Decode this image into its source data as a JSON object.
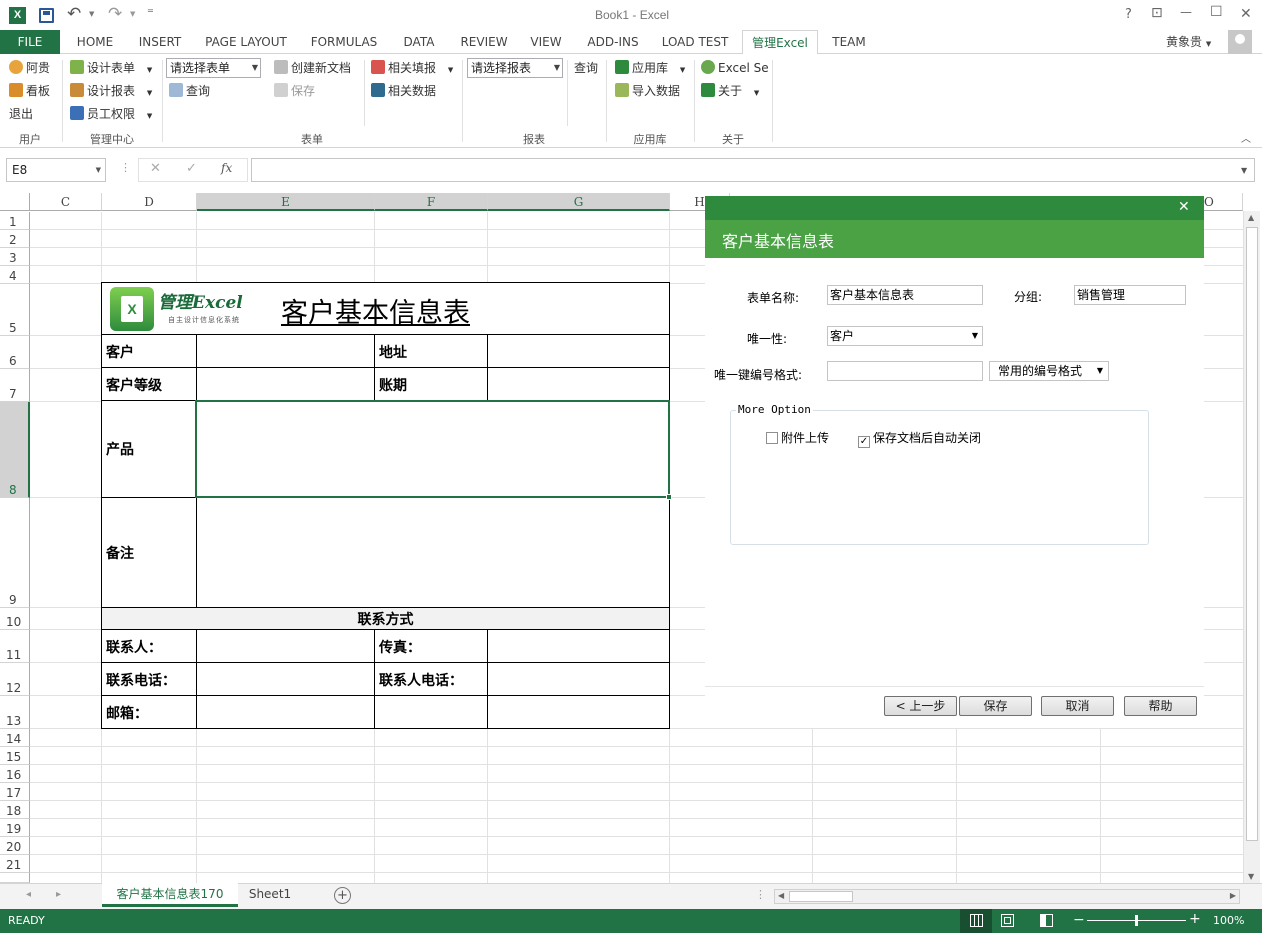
{
  "window": {
    "title": "Book1 - Excel",
    "help": "?",
    "ribbon_opts": "⊡",
    "minimize": "—",
    "maximize": "☐",
    "close": "✕"
  },
  "quick_access": {
    "undo": "↶",
    "redo": "↷",
    "customize": "⁼"
  },
  "tabs": [
    "FILE",
    "HOME",
    "INSERT",
    "PAGE LAYOUT",
    "FORMULAS",
    "DATA",
    "REVIEW",
    "VIEW",
    "ADD-INS",
    "LOAD TEST",
    "管理Excel",
    "TEAM"
  ],
  "user": {
    "name": "黄象贵"
  },
  "ribbon": {
    "user_group": {
      "label": "用户",
      "items": [
        "阿贵",
        "看板",
        "退出"
      ]
    },
    "mgmt_group": {
      "label": "管理中心",
      "items": [
        "设计表单",
        "设计报表",
        "员工权限"
      ]
    },
    "form_group": {
      "label": "表单",
      "combo": "请选择表单",
      "items": [
        "查询",
        "创建新文档",
        "保存",
        "相关填报",
        "相关数据"
      ]
    },
    "report_group": {
      "label": "报表",
      "combo": "请选择报表",
      "query": "查询"
    },
    "app_group": {
      "label": "应用库",
      "items": [
        "应用库",
        "导入数据"
      ]
    },
    "about_group": {
      "label": "关于",
      "items": [
        "Excel Se",
        "关于"
      ]
    }
  },
  "formula_bar": {
    "name_box": "E8",
    "cancel": "✕",
    "enter": "✓",
    "fx": "fx",
    "formula": ""
  },
  "columns": [
    "C",
    "D",
    "E",
    "F",
    "G"
  ],
  "col_extra": {
    "h": "H",
    "o": "O"
  },
  "rows": [
    "1",
    "2",
    "3",
    "4",
    "5",
    "6",
    "7",
    "8",
    "9",
    "10",
    "11",
    "12",
    "13",
    "14",
    "15",
    "16",
    "17",
    "18",
    "19",
    "20",
    "21"
  ],
  "sheet": {
    "logo_title": "管理Excel",
    "logo_subtitle": "自主设计信息化系统",
    "form_title": "客户基本信息表",
    "customer": "客户",
    "address": "地址",
    "customer_level": "客户等级",
    "account_period": "账期",
    "product": "产品",
    "remark": "备注",
    "contact_section": "联系方式",
    "contact_person": "联系人：",
    "fax": "传真：",
    "contact_phone": "联系电话：",
    "contact_person_phone": "联系人电话：",
    "email": "邮箱："
  },
  "dialog": {
    "title": "客户基本信息表",
    "close": "✕",
    "form_name_label": "表单名称:",
    "form_name_value": "客户基本信息表",
    "group_label": "分组:",
    "group_value": "销售管理",
    "unique_label": "唯一性:",
    "unique_value": "客户",
    "key_format_label": "唯一键编号格式:",
    "key_format_value": "",
    "key_format_combo": "常用的编号格式",
    "more_option": "More Option",
    "attachment": "附件上传",
    "attachment_checked": false,
    "auto_close": "保存文档后自动关闭",
    "auto_close_checked": true,
    "buttons": {
      "prev": "< 上一步",
      "save": "保存",
      "cancel": "取消",
      "help": "帮助"
    }
  },
  "sheet_tabs": {
    "active": "客户基本信息表170",
    "other": "Sheet1",
    "add": "+"
  },
  "status": {
    "ready": "READY",
    "zoom": "100%"
  },
  "colors": {
    "excel_green": "#217346",
    "dialog_header": "#4aa245",
    "dialog_top": "#2e8b3d"
  }
}
